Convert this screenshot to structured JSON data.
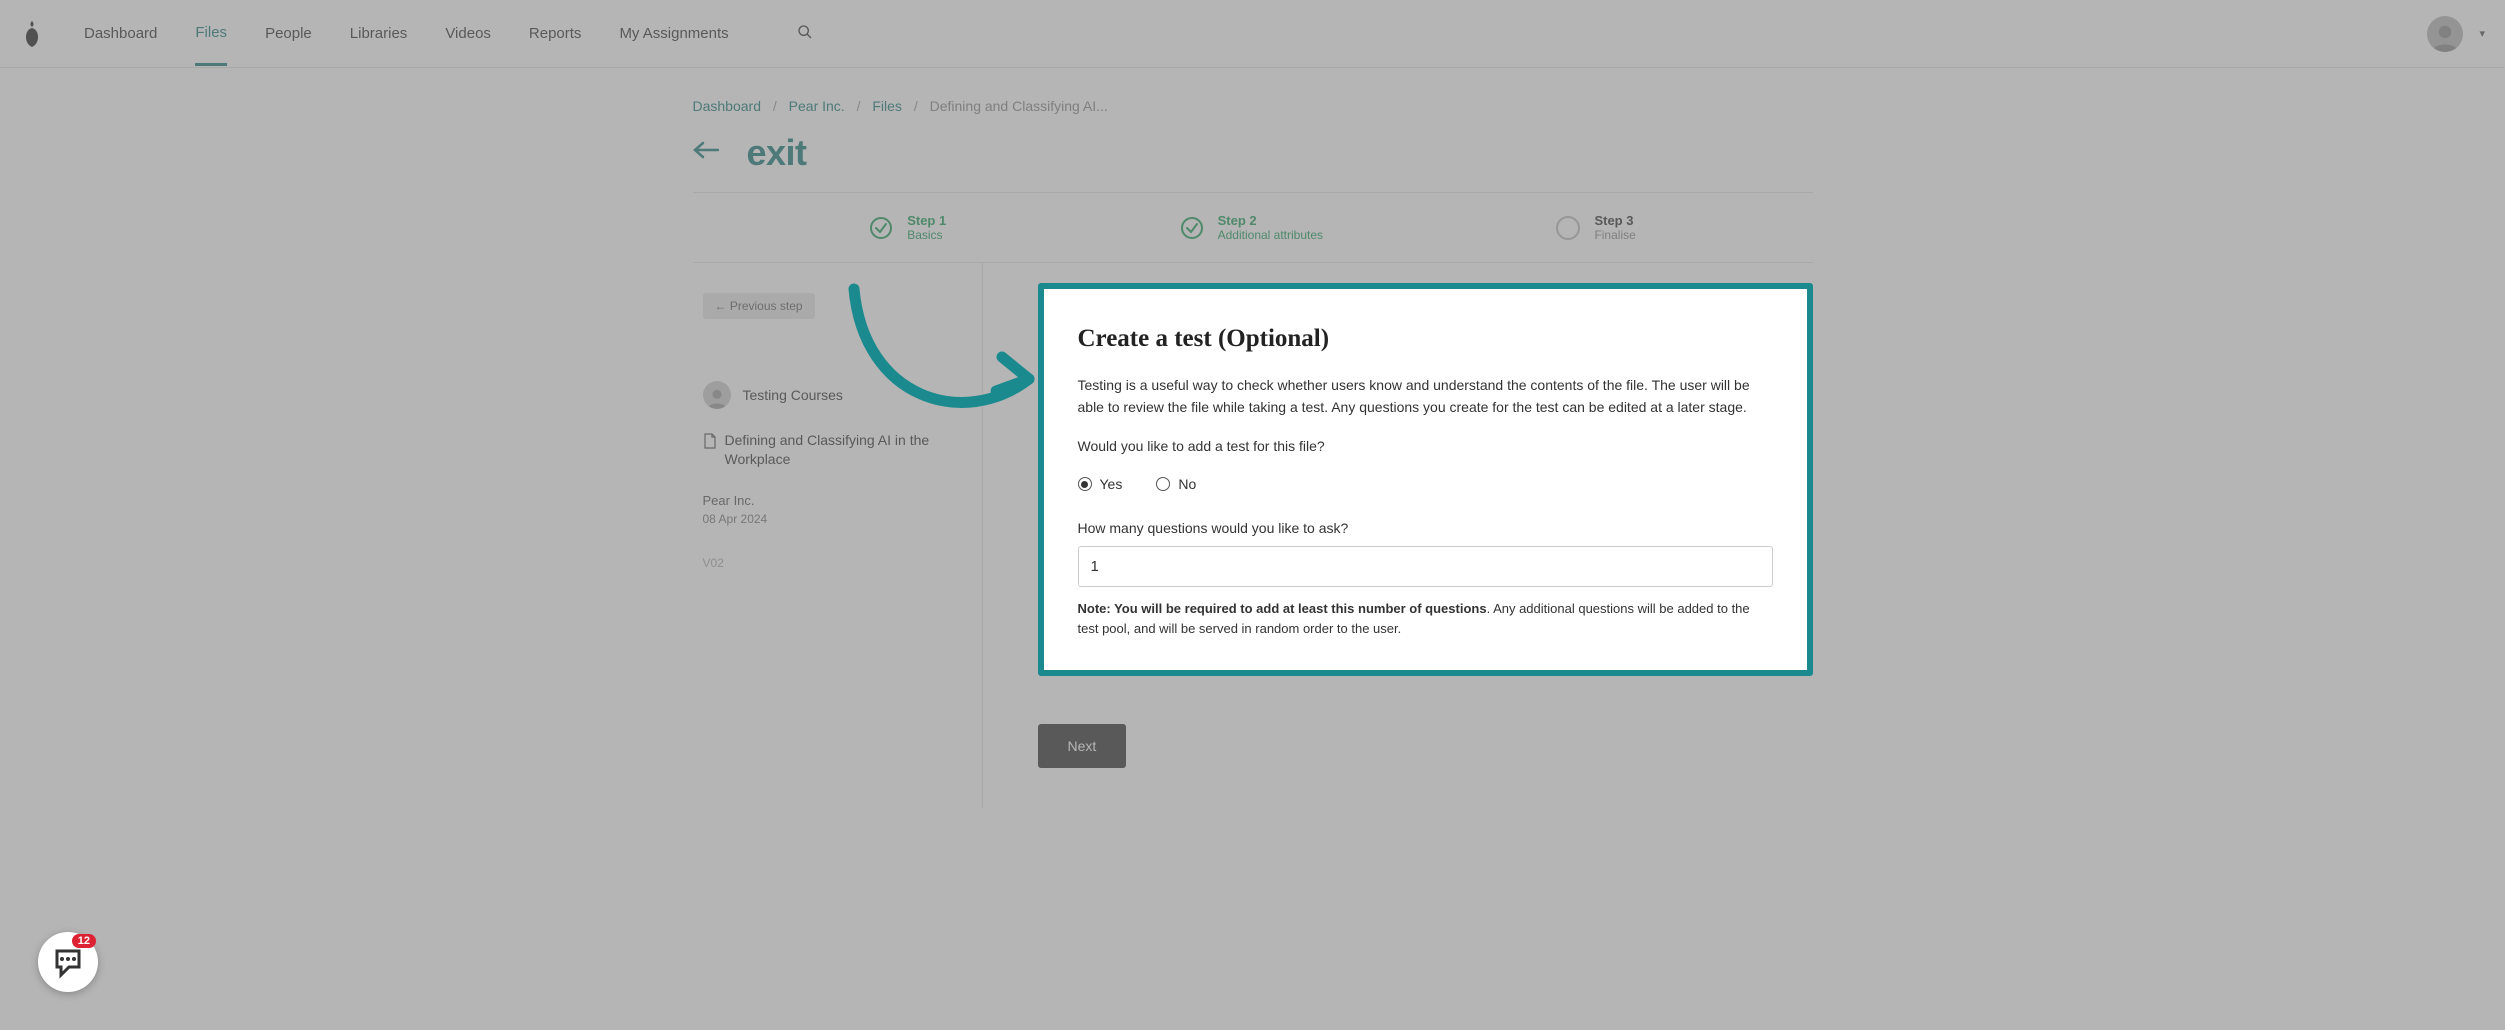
{
  "nav": {
    "items": [
      {
        "label": "Dashboard"
      },
      {
        "label": "Files",
        "active": true
      },
      {
        "label": "People"
      },
      {
        "label": "Libraries"
      },
      {
        "label": "Videos"
      },
      {
        "label": "Reports"
      },
      {
        "label": "My Assignments"
      }
    ]
  },
  "breadcrumbs": {
    "dashboard": "Dashboard",
    "org": "Pear Inc.",
    "files": "Files",
    "current": "Defining and Classifying AI..."
  },
  "exit_label": "exit",
  "stepper": {
    "steps": [
      {
        "title": "Step 1",
        "sub": "Basics",
        "state": "done"
      },
      {
        "title": "Step 2",
        "sub": "Additional attributes",
        "state": "done"
      },
      {
        "title": "Step 3",
        "sub": "Finalise",
        "state": "pending"
      }
    ]
  },
  "left_panel": {
    "prev_label": "←  Previous step",
    "author": "Testing Courses",
    "doc_title": "Defining and Classifying AI in the Workplace",
    "org": "Pear Inc.",
    "date": "08 Apr 2024",
    "version": "V02"
  },
  "form": {
    "title": "Create a test (Optional)",
    "intro": "Testing is a useful way to check whether users know and understand the contents of the file. The user will be able to review the file while taking a test. Any questions you create for the test can be edited at a later stage.",
    "question_prompt": "Would you like to add a test for this file?",
    "radio_yes": "Yes",
    "radio_no": "No",
    "count_label": "How many questions would you like to ask?",
    "count_value": "1",
    "note_strong": "Note: You will be required to add at least this number of questions",
    "note_rest": ". Any additional questions will be added to the test pool, and will be served in random order to the user.",
    "next_label": "Next"
  },
  "help": {
    "badge": "12"
  }
}
